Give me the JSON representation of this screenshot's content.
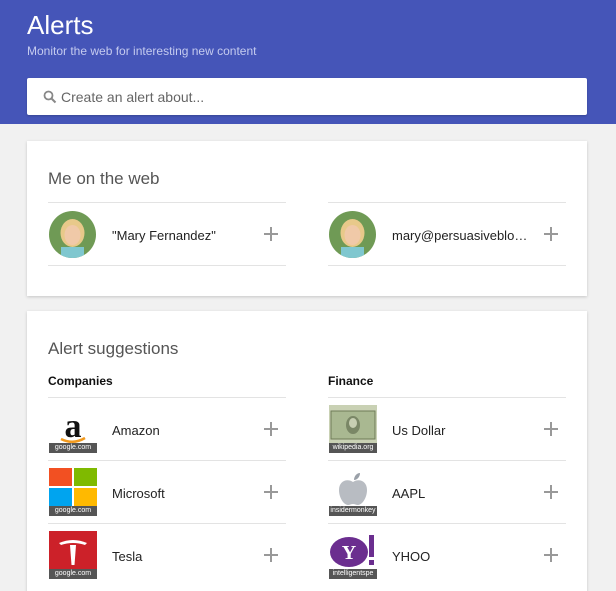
{
  "header": {
    "title": "Alerts",
    "subtitle": "Monitor the web for interesting new content"
  },
  "search": {
    "placeholder": "Create an alert about..."
  },
  "me_on_web": {
    "heading": "Me on the web",
    "items": [
      {
        "label": "\"Mary Fernandez\""
      },
      {
        "label": "mary@persuasiveblog..."
      }
    ]
  },
  "suggestions": {
    "heading": "Alert suggestions",
    "companies": {
      "title": "Companies",
      "items": [
        {
          "label": "Amazon",
          "source": "google.com"
        },
        {
          "label": "Microsoft",
          "source": "google.com"
        },
        {
          "label": "Tesla",
          "source": "google.com"
        }
      ]
    },
    "finance": {
      "title": "Finance",
      "items": [
        {
          "label": "Us Dollar",
          "source": "wikipedia.org"
        },
        {
          "label": "AAPL",
          "source": "insidermonkey"
        },
        {
          "label": "YHOO",
          "source": "intelligentspe"
        }
      ]
    }
  },
  "colors": {
    "header_bg": "#4555b8",
    "page_bg": "#f1f1f1"
  }
}
